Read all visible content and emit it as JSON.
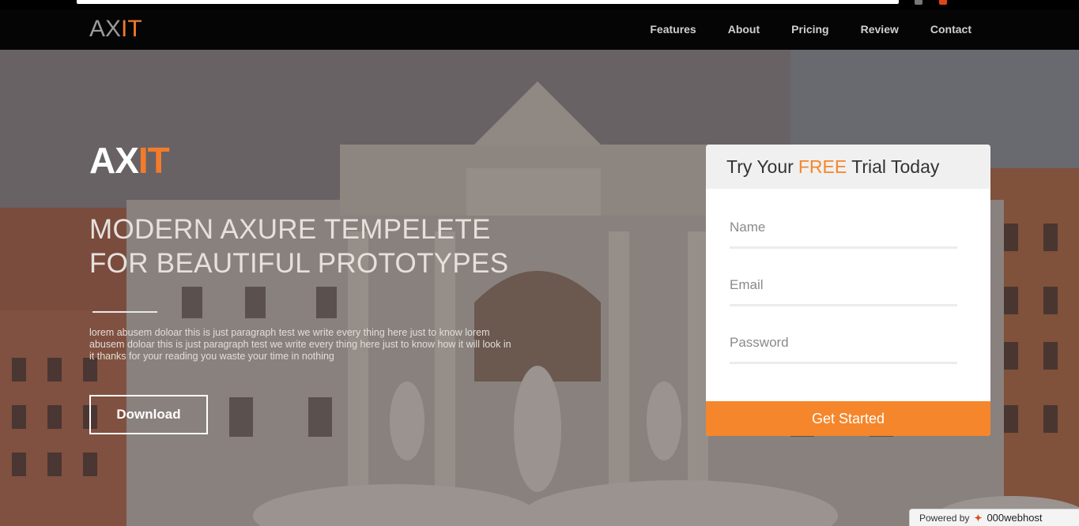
{
  "navbar": {
    "logo_ax": "AX",
    "logo_it": "IT",
    "links": [
      "Features",
      "About",
      "Pricing",
      "Review",
      "Contact"
    ]
  },
  "hero": {
    "logo_ax": "AX",
    "logo_it": "IT",
    "headline_line1": "MODERN AXURE TEMPELETE",
    "headline_line2": "FOR BEAUTIFUL PROTOTYPES",
    "paragraph": "lorem abusem doloar this is just paragraph test we write every thing here just to know lorem abusem doloar this is just paragraph test we write every thing here just to know how it will look in it thanks for your reading you waste your time in nothing",
    "download_label": "Download"
  },
  "form": {
    "title_prefix": "Try Your",
    "title_free": "FREE",
    "title_suffix": "Trial Today",
    "name_placeholder": "Name",
    "email_placeholder": "Email",
    "password_placeholder": "Password",
    "submit_label": "Get Started"
  },
  "footer_badge": {
    "powered_by": "Powered by",
    "brand": "000webhost"
  },
  "colors": {
    "accent": "#f5862b",
    "nav_bg": "#050505"
  }
}
